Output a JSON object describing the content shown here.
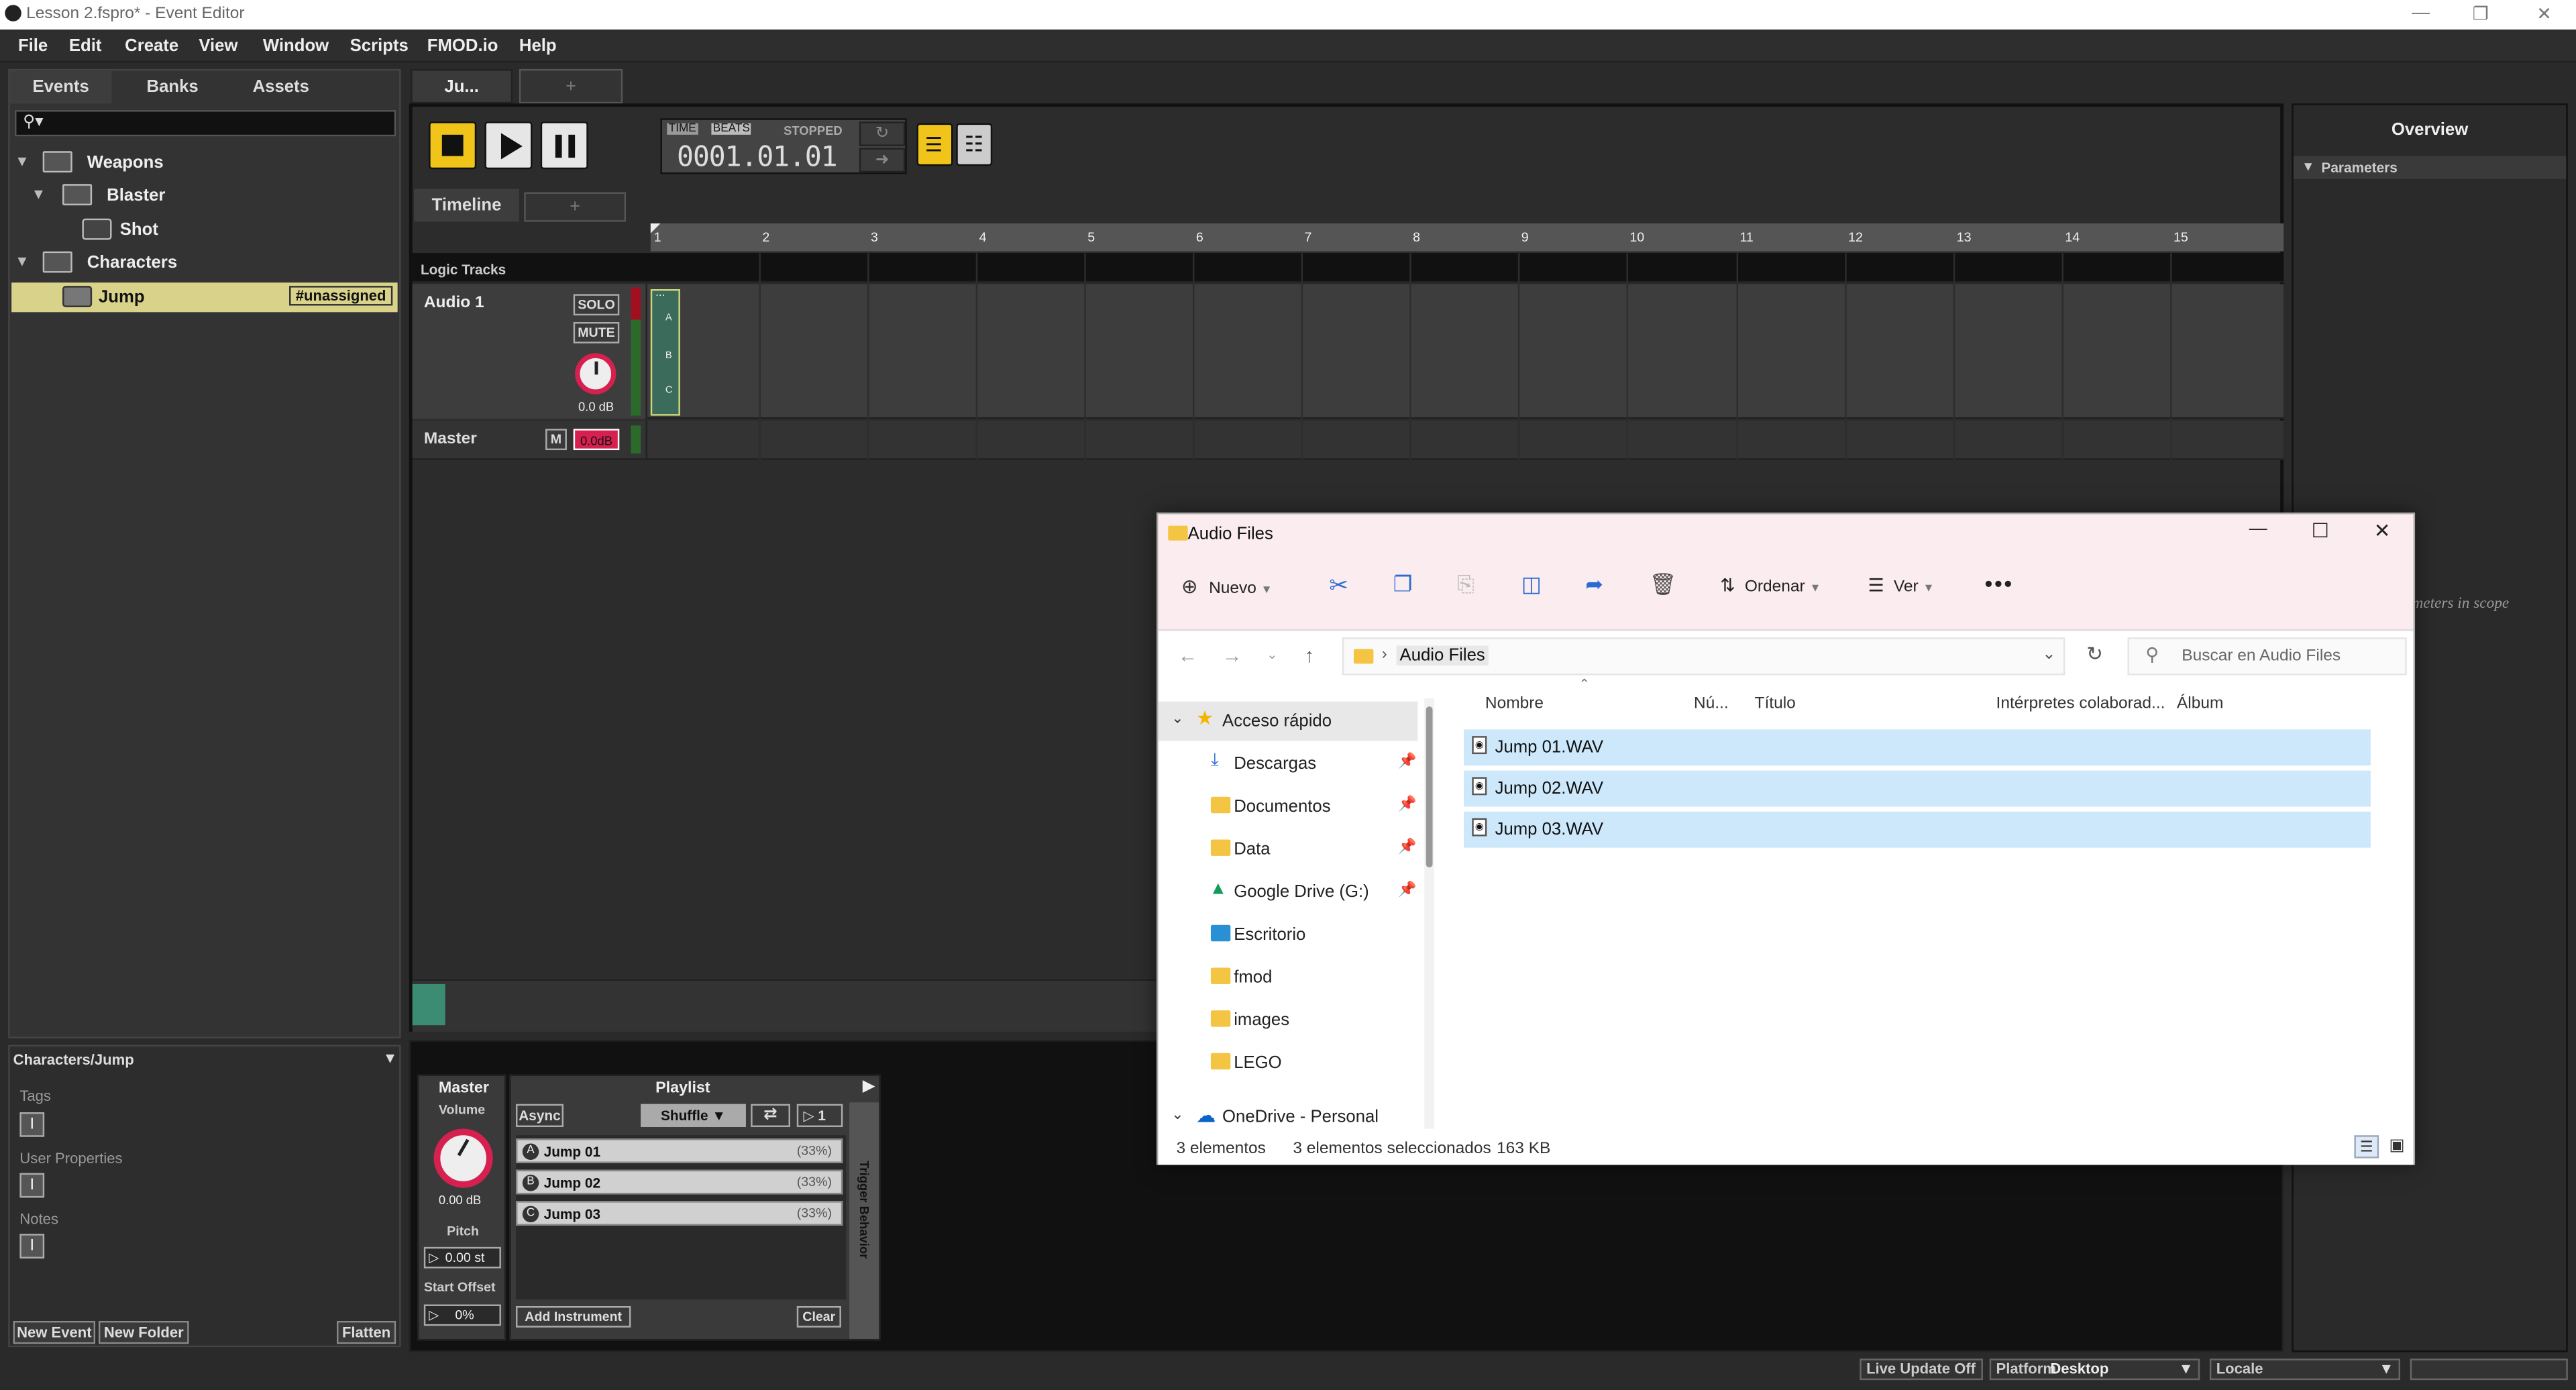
{
  "window": {
    "title": "Lesson 2.fspro* - Event Editor"
  },
  "menu": [
    "File",
    "Edit",
    "Create",
    "View",
    "Window",
    "Scripts",
    "FMOD.io",
    "Help"
  ],
  "browser": {
    "tabs": [
      "Events",
      "Banks",
      "Assets"
    ],
    "tree": [
      {
        "label": "Weapons",
        "type": "folder"
      },
      {
        "label": "Blaster",
        "type": "folder"
      },
      {
        "label": "Shot",
        "type": "event"
      },
      {
        "label": "Characters",
        "type": "folder"
      },
      {
        "label": "Jump",
        "type": "event",
        "badge": "#unassigned"
      }
    ],
    "path": "Characters/Jump",
    "sections": [
      "Tags",
      "User Properties",
      "Notes"
    ],
    "buttons": {
      "new_event": "New Event",
      "new_folder": "New Folder",
      "flatten": "Flatten"
    }
  },
  "editor": {
    "event_tab": "Ju...",
    "add_tab": "+",
    "time_label": "TIME",
    "beats_label": "BEATS",
    "state": "STOPPED",
    "position": "0001.01.01",
    "timeline_tab": "Timeline",
    "ruler": [
      "1",
      "2",
      "3",
      "4",
      "5",
      "6",
      "7",
      "8",
      "9",
      "10",
      "11",
      "12",
      "13",
      "14",
      "15"
    ],
    "logic_tracks": "Logic Tracks",
    "tracks": [
      {
        "name": "Audio 1",
        "solo": "SOLO",
        "mute": "MUTE",
        "db": "0.0 dB"
      }
    ],
    "master": {
      "name": "Master",
      "m": "M",
      "db": "0.0dB"
    },
    "clip_labels": [
      "...",
      "A",
      "B",
      "C"
    ]
  },
  "overview": {
    "title": "Overview",
    "parameters": "Parameters",
    "empty": "...meters in scope"
  },
  "deck": {
    "master": "Master",
    "volume_label": "Volume",
    "volume_value": "0.00 dB",
    "pitch_label": "Pitch",
    "pitch_value": "0.00 st",
    "start_offset_label": "Start Offset",
    "start_offset_value": "0%",
    "playlist_title": "Playlist",
    "async": "Async",
    "mode": "Shuffle",
    "count": "1",
    "items": [
      {
        "letter": "A",
        "name": "Jump 01",
        "pct": "(33%)"
      },
      {
        "letter": "B",
        "name": "Jump 02",
        "pct": "(33%)"
      },
      {
        "letter": "C",
        "name": "Jump 03",
        "pct": "(33%)"
      }
    ],
    "add_instrument": "Add Instrument",
    "clear": "Clear",
    "trigger": "Trigger Behavior"
  },
  "status": {
    "live_update": "Live Update Off",
    "platform_label": "Platform",
    "platform_value": "Desktop",
    "locale_label": "Locale"
  },
  "explorer": {
    "title": "Audio Files",
    "toolbar": {
      "new": "Nuevo",
      "sort": "Ordenar",
      "view": "Ver"
    },
    "crumb": "Audio Files",
    "search_placeholder": "Buscar en Audio Files",
    "nav": [
      {
        "label": "Acceso rápido",
        "type": "star",
        "expanded": true
      },
      {
        "label": "Descargas",
        "type": "download",
        "pinned": true
      },
      {
        "label": "Documentos",
        "type": "folder",
        "pinned": true
      },
      {
        "label": "Data",
        "type": "folder",
        "pinned": true
      },
      {
        "label": "Google Drive (G:)",
        "type": "drive",
        "pinned": true
      },
      {
        "label": "Escritorio",
        "type": "desktop"
      },
      {
        "label": "fmod",
        "type": "folder"
      },
      {
        "label": "images",
        "type": "folder"
      },
      {
        "label": "LEGO",
        "type": "folder"
      },
      {
        "label": "OneDrive - Personal",
        "type": "cloud",
        "expanded": true
      }
    ],
    "columns": [
      "Nombre",
      "Nú...",
      "Título",
      "Intérpretes colaborad...",
      "Álbum"
    ],
    "files": [
      "Jump 01.WAV",
      "Jump 02.WAV",
      "Jump 03.WAV"
    ],
    "status": {
      "count": "3 elementos",
      "selected": "3 elementos seleccionados",
      "size": "163 KB"
    }
  }
}
